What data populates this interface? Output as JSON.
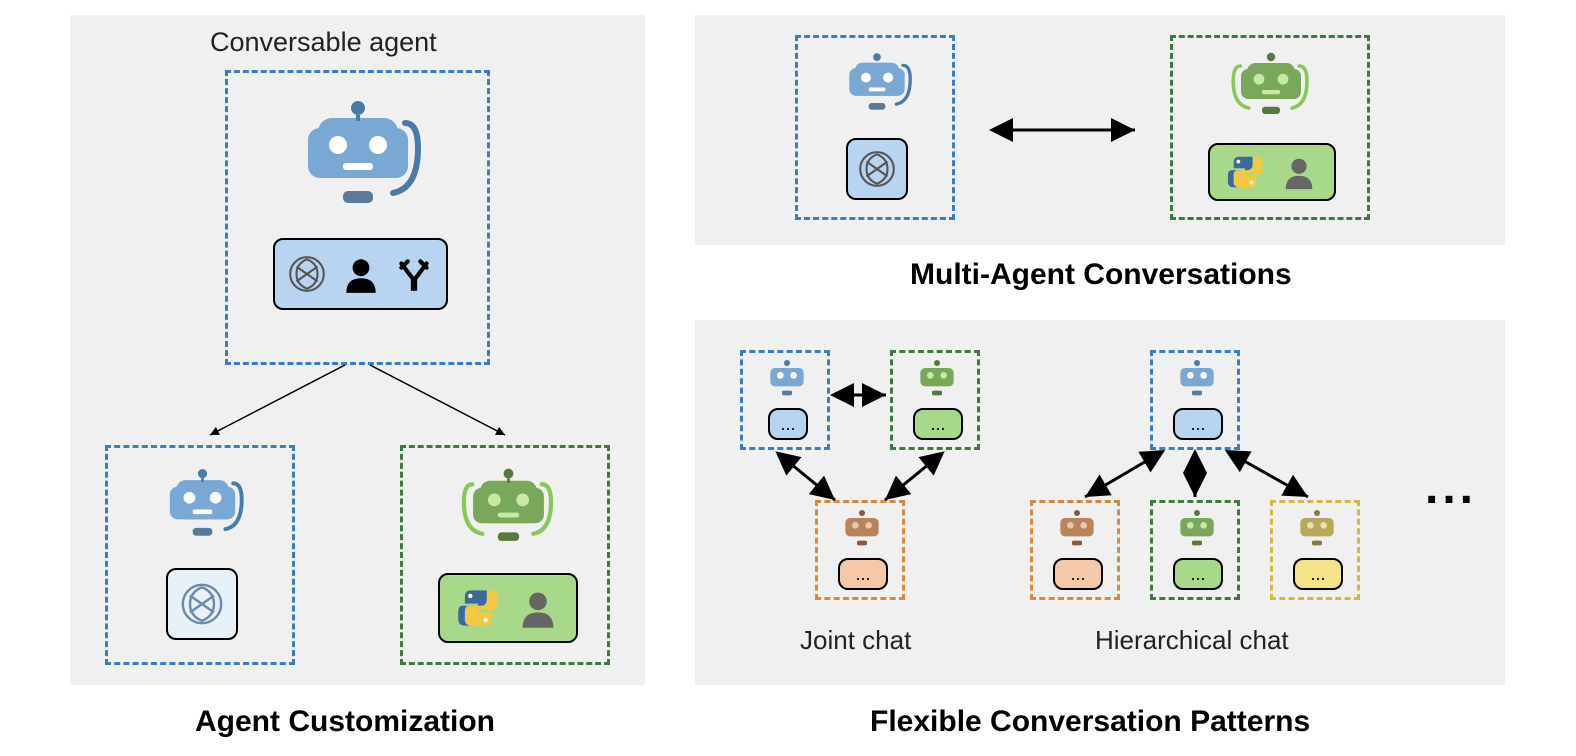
{
  "left_panel": {
    "inner_title": "Conversable agent",
    "caption": "Agent Customization"
  },
  "top_right": {
    "caption": "Multi-Agent Conversations"
  },
  "bottom_right": {
    "joint_label": "Joint chat",
    "hier_label": "Hierarchical chat",
    "caption": "Flexible Conversation Patterns",
    "ellipsis": "..."
  },
  "box_ellipsis": "...",
  "colors": {
    "blue_robot": "#7aa8d4",
    "blue_robot_dark": "#4a7aa8",
    "green_robot": "#7aa85a",
    "green_robot_dark": "#567a3e",
    "orange_robot": "#b8845a",
    "yellow_robot": "#b8a85a"
  }
}
